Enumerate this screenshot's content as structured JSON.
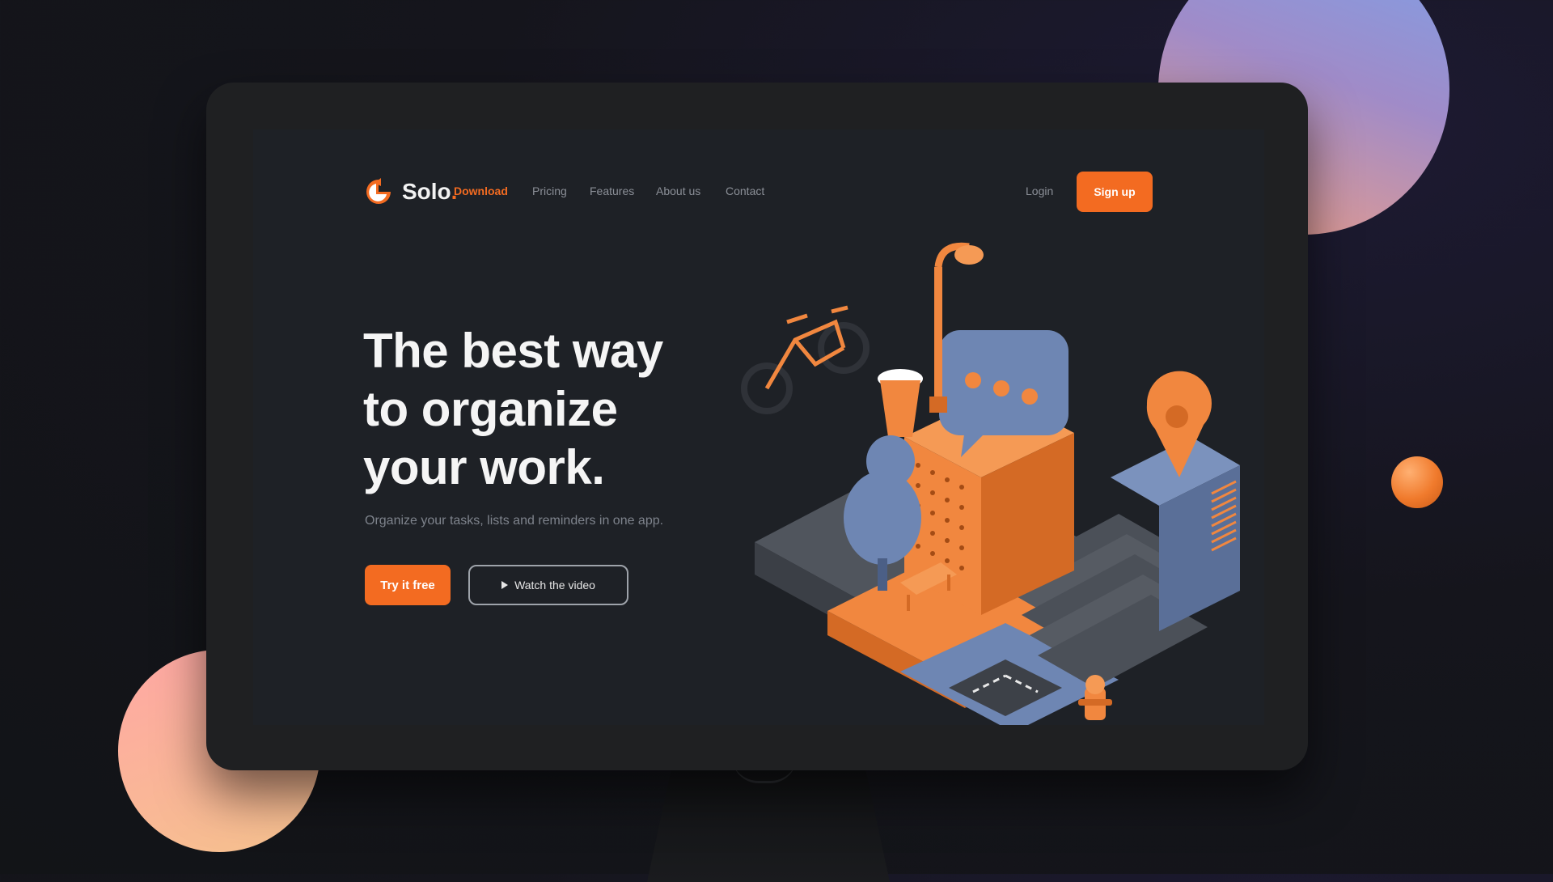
{
  "colors": {
    "accent": "#f36b21",
    "screen_bg": "#1e2126",
    "muted_text": "#8b8f97",
    "eyebrow": "#6f8fc4",
    "blue_block": "#6e86b3",
    "grey_block": "#4a4f57"
  },
  "brand": {
    "name": "Solo",
    "dot": "."
  },
  "nav": {
    "items": [
      "Download",
      "Pricing",
      "Features",
      "About us",
      "Contact"
    ],
    "active_index": 0,
    "login_label": "Login",
    "signup_label": "Sign up"
  },
  "hero": {
    "eyebrow": "",
    "headline_lines": [
      "The best way",
      "to organize",
      "your work."
    ],
    "subtext": "Organize your tasks, lists and reminders in one app.",
    "primary_cta": "Try it free",
    "secondary_cta": "Watch the video"
  },
  "illustration": {
    "description_icon": "isometric-city-illustration",
    "elements": [
      "bicycle",
      "street-lamp",
      "chat-bubble",
      "coffee-cup",
      "location-pin",
      "building",
      "stairs",
      "fire-hydrant",
      "tree"
    ]
  }
}
